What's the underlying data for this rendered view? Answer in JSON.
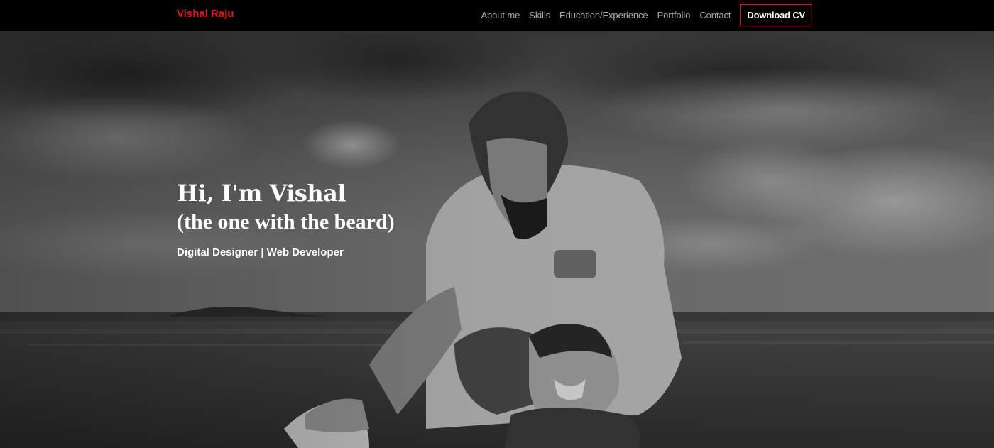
{
  "nav": {
    "brand": "Vishal Raju",
    "links": [
      "About me",
      "Skills",
      "Education/Experience",
      "Portfolio",
      "Contact"
    ],
    "cv_button": "Download CV"
  },
  "hero": {
    "title": "Hi, I'm Vishal",
    "subtitle": "(the one with the beard)",
    "tagline": "Digital Designer | Web Developer",
    "background": "black-and-white beach photo of a bearded man crouching with a smiling toddler"
  },
  "colors": {
    "accent": "#e3121b",
    "nav_bg": "#000000",
    "nav_link": "#a9a9a9",
    "text": "#ffffff"
  }
}
